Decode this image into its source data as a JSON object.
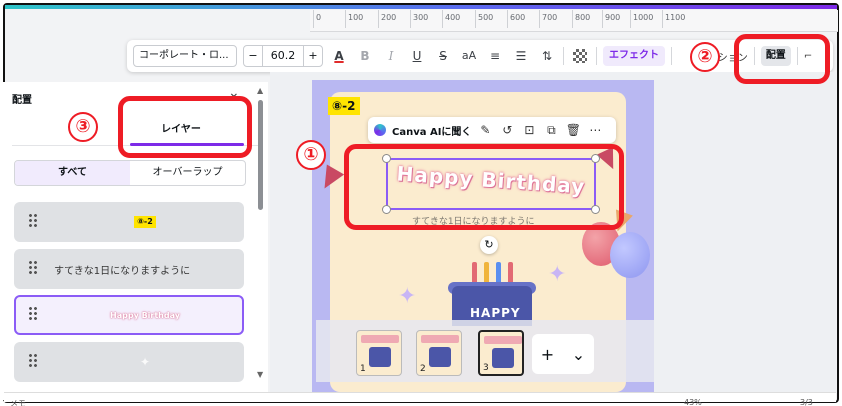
{
  "ruler": {
    "ticks": [
      "0",
      "100",
      "200",
      "300",
      "400",
      "500",
      "600",
      "700",
      "800",
      "900",
      "1000",
      "1100"
    ]
  },
  "toolbar": {
    "font_name": "コーポレート・ロ...",
    "size_decrease": "−",
    "font_size": "60.2",
    "size_increase": "+",
    "color_label": "A",
    "bold_label": "B",
    "italic_label": "I",
    "underline_label": "U",
    "strike_label": "S",
    "case_label": "aA",
    "align_icon": "≡",
    "list_icon": "☰",
    "spacing_icon": "⇅",
    "effect_label": "エフェクト",
    "animate_partial": "ーション",
    "arrange_label": "配置"
  },
  "panel": {
    "title": "配置",
    "tab_label": "レイヤー",
    "filter_all": "すべて",
    "filter_overlap": "オーバーラップ",
    "layers": [
      {
        "kind": "badge",
        "text": "⑧-2"
      },
      {
        "kind": "text",
        "text": "すてきな1日になりますように"
      },
      {
        "kind": "styled",
        "text": "Happy Birthday"
      },
      {
        "kind": "sparkle",
        "text": "✦"
      }
    ]
  },
  "canvas": {
    "page_tag": "⑧-2",
    "ai_label": "Canva AIに聞く",
    "headline": "Happy Birthday",
    "subtitle": "すてきな1日になりますように",
    "cake_text": "HAPPY",
    "rotate_icon": "↻"
  },
  "thumbnails": [
    {
      "num": "1"
    },
    {
      "num": "2"
    },
    {
      "num": "3"
    }
  ],
  "add_page": {
    "plus": "+",
    "chevron": "⌄"
  },
  "callouts": {
    "one": "①",
    "two": "②",
    "three": "③"
  },
  "status": {
    "notes": "メモ",
    "zoom": "43%",
    "pages": "3/3"
  },
  "colors": {
    "accent": "#7d2ae8",
    "callout": "#ee1c25",
    "badge": "#ffe400",
    "selection": "#8b5cf6"
  }
}
